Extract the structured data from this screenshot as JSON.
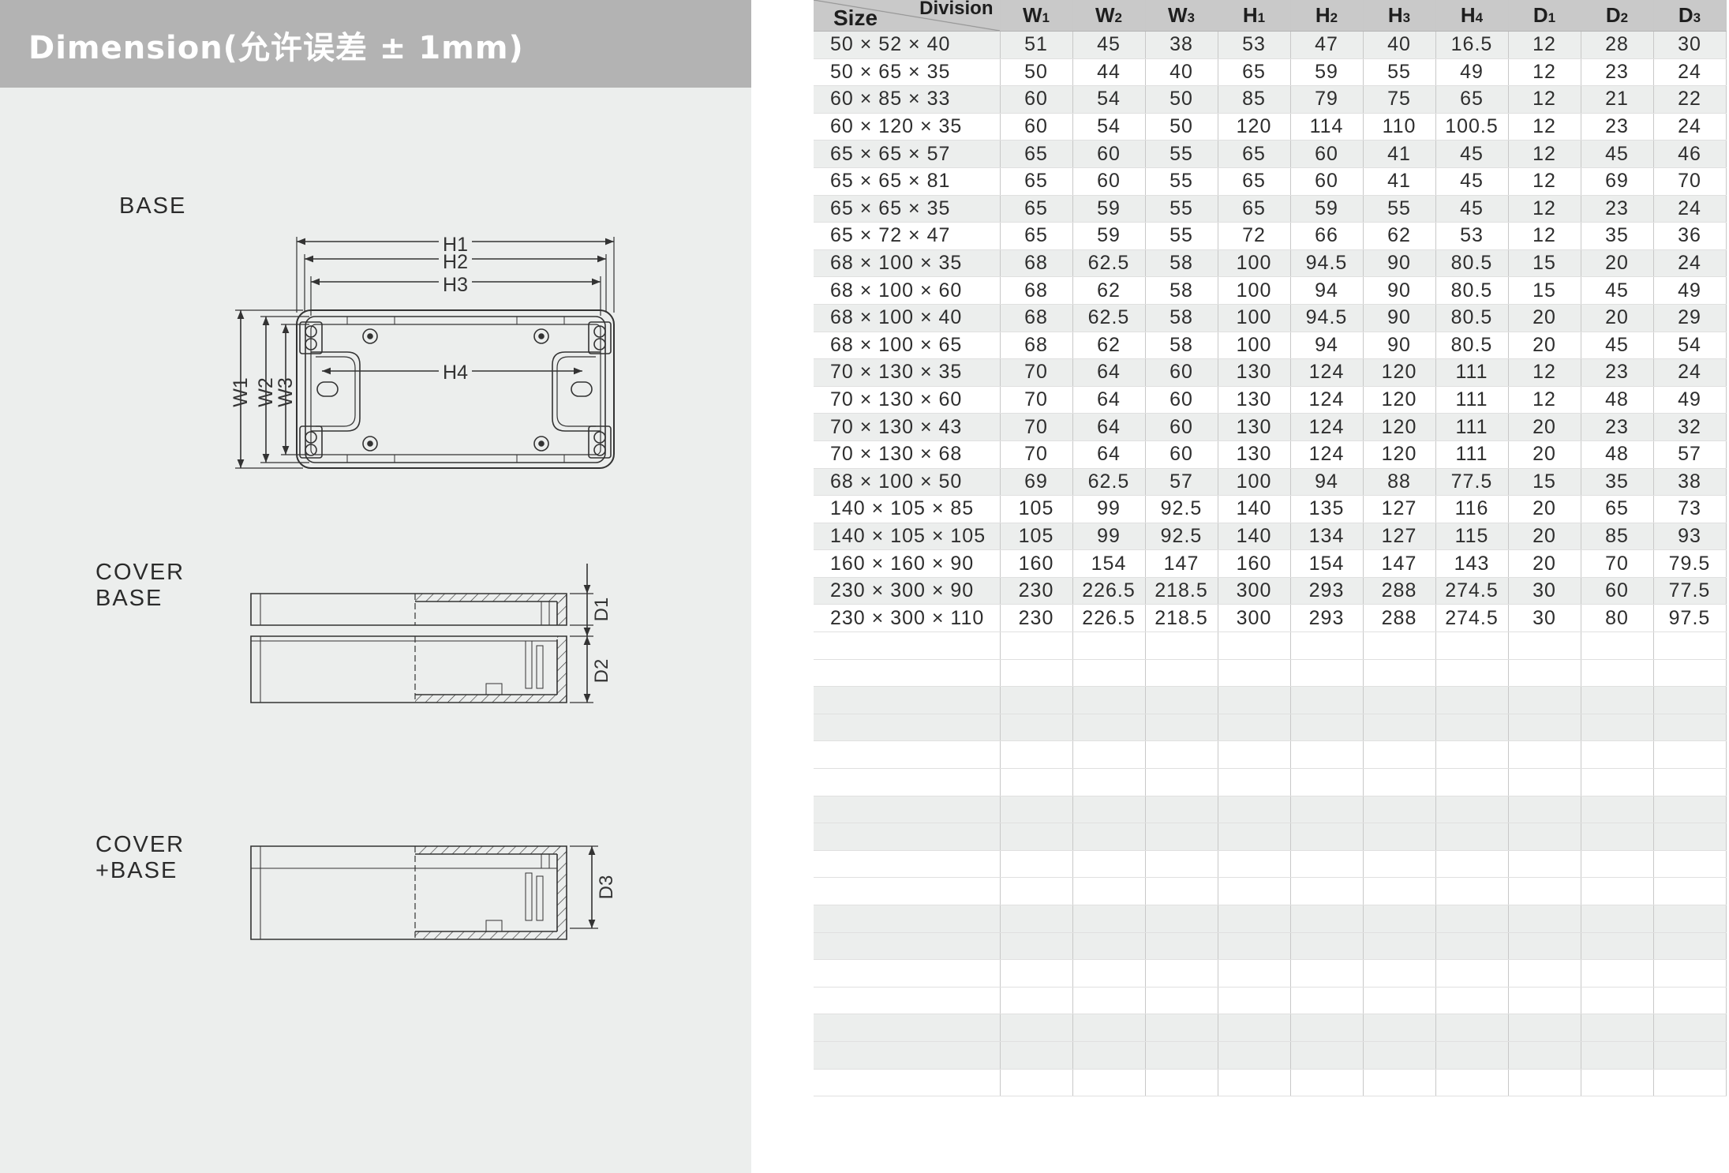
{
  "header": {
    "title": "Dimension(允许误差 ± 1mm)"
  },
  "views": {
    "base": {
      "label": "BASE",
      "dims": {
        "h1": "H1",
        "h2": "H2",
        "h3": "H3",
        "h4": "H4",
        "w1": "W1",
        "w2": "W2",
        "w3": "W3"
      }
    },
    "cover_base": {
      "label_line1": "COVER",
      "label_line2": "BASE",
      "dims": {
        "d1": "D1",
        "d2": "D2"
      }
    },
    "cover_plus_base": {
      "label_line1": "COVER",
      "label_line2": "+BASE",
      "dims": {
        "d3": "D3"
      }
    }
  },
  "table": {
    "corner": {
      "division": "Division",
      "size": "Size"
    },
    "columns": [
      {
        "letter": "W",
        "sub": "1"
      },
      {
        "letter": "W",
        "sub": "2"
      },
      {
        "letter": "W",
        "sub": "3"
      },
      {
        "letter": "H",
        "sub": "1"
      },
      {
        "letter": "H",
        "sub": "2"
      },
      {
        "letter": "H",
        "sub": "3"
      },
      {
        "letter": "H",
        "sub": "4"
      },
      {
        "letter": "D",
        "sub": "1"
      },
      {
        "letter": "D",
        "sub": "2"
      },
      {
        "letter": "D",
        "sub": "3"
      }
    ],
    "rows": [
      [
        "50 × 52 × 40",
        "51",
        "45",
        "38",
        "53",
        "47",
        "40",
        "16.5",
        "12",
        "28",
        "30"
      ],
      [
        "50 × 65 × 35",
        "50",
        "44",
        "40",
        "65",
        "59",
        "55",
        "49",
        "12",
        "23",
        "24"
      ],
      [
        "60 × 85 × 33",
        "60",
        "54",
        "50",
        "85",
        "79",
        "75",
        "65",
        "12",
        "21",
        "22"
      ],
      [
        "60 × 120 × 35",
        "60",
        "54",
        "50",
        "120",
        "114",
        "110",
        "100.5",
        "12",
        "23",
        "24"
      ],
      [
        "65 × 65 × 57",
        "65",
        "60",
        "55",
        "65",
        "60",
        "41",
        "45",
        "12",
        "45",
        "46"
      ],
      [
        "65 × 65 × 81",
        "65",
        "60",
        "55",
        "65",
        "60",
        "41",
        "45",
        "12",
        "69",
        "70"
      ],
      [
        "65 × 65 × 35",
        "65",
        "59",
        "55",
        "65",
        "59",
        "55",
        "45",
        "12",
        "23",
        "24"
      ],
      [
        "65 × 72 × 47",
        "65",
        "59",
        "55",
        "72",
        "66",
        "62",
        "53",
        "12",
        "35",
        "36"
      ],
      [
        "68 × 100 × 35",
        "68",
        "62.5",
        "58",
        "100",
        "94.5",
        "90",
        "80.5",
        "15",
        "20",
        "24"
      ],
      [
        "68 × 100 × 60",
        "68",
        "62",
        "58",
        "100",
        "94",
        "90",
        "80.5",
        "15",
        "45",
        "49"
      ],
      [
        "68 × 100 × 40",
        "68",
        "62.5",
        "58",
        "100",
        "94.5",
        "90",
        "80.5",
        "20",
        "20",
        "29"
      ],
      [
        "68 × 100 × 65",
        "68",
        "62",
        "58",
        "100",
        "94",
        "90",
        "80.5",
        "20",
        "45",
        "54"
      ],
      [
        "70 × 130 × 35",
        "70",
        "64",
        "60",
        "130",
        "124",
        "120",
        "111",
        "12",
        "23",
        "24"
      ],
      [
        "70 × 130 × 60",
        "70",
        "64",
        "60",
        "130",
        "124",
        "120",
        "111",
        "12",
        "48",
        "49"
      ],
      [
        "70 × 130 × 43",
        "70",
        "64",
        "60",
        "130",
        "124",
        "120",
        "111",
        "20",
        "23",
        "32"
      ],
      [
        "70 × 130 × 68",
        "70",
        "64",
        "60",
        "130",
        "124",
        "120",
        "111",
        "20",
        "48",
        "57"
      ],
      [
        "68 × 100 × 50",
        "69",
        "62.5",
        "57",
        "100",
        "94",
        "88",
        "77.5",
        "15",
        "35",
        "38"
      ],
      [
        "140 × 105 × 85",
        "105",
        "99",
        "92.5",
        "140",
        "135",
        "127",
        "116",
        "20",
        "65",
        "73"
      ],
      [
        "140 × 105 × 105",
        "105",
        "99",
        "92.5",
        "140",
        "134",
        "127",
        "115",
        "20",
        "85",
        "93"
      ],
      [
        "160 × 160 × 90",
        "160",
        "154",
        "147",
        "160",
        "154",
        "147",
        "143",
        "20",
        "70",
        "79.5"
      ],
      [
        "230 × 300 × 90",
        "230",
        "226.5",
        "218.5",
        "300",
        "293",
        "288",
        "274.5",
        "30",
        "60",
        "77.5"
      ],
      [
        "230 × 300 × 110",
        "230",
        "226.5",
        "218.5",
        "300",
        "293",
        "288",
        "274.5",
        "30",
        "80",
        "97.5"
      ]
    ],
    "empty_row_count": 17
  }
}
